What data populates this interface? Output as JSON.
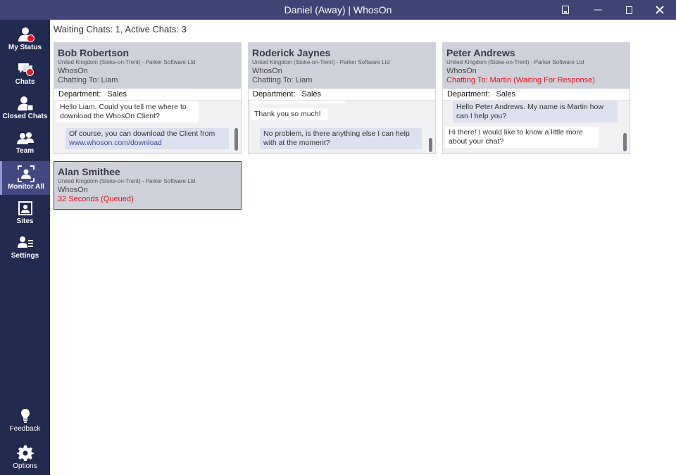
{
  "window": {
    "title": "Daniel (Away)  | WhosOn"
  },
  "sidebar": {
    "items": [
      {
        "label": "My Status",
        "icon": "user-status-icon"
      },
      {
        "label": "Chats",
        "icon": "chat-bubbles-icon"
      },
      {
        "label": "Closed Chats",
        "icon": "closed-chats-icon"
      },
      {
        "label": "Team",
        "icon": "team-icon"
      },
      {
        "label": "Monitor All",
        "icon": "monitor-all-icon",
        "active": true
      },
      {
        "label": "Sites",
        "icon": "sites-icon"
      },
      {
        "label": "Settings",
        "icon": "settings-user-icon"
      }
    ],
    "bottom": [
      {
        "label": "Feedback",
        "icon": "lightbulb-icon"
      },
      {
        "label": "Options",
        "icon": "gear-icon"
      }
    ]
  },
  "main": {
    "summary": "Waiting Chats: 1, Active Chats: 3",
    "cards": [
      {
        "name": "Bob Robertson",
        "location": "United Kingdom (Stoke-on-Trent) - Parker Software Ltd",
        "site": "WhosOn",
        "status": "Chatting To: Liam",
        "department_label": "Department:",
        "department": "Sales",
        "messages": [
          {
            "from": "visitor",
            "text": "Hello Liam. Could you tell me where to download the WhosOn Client?"
          },
          {
            "from": "operator",
            "text": "Of course, you can download the Client from",
            "link": "www.whoson.com/download"
          }
        ]
      },
      {
        "name": "Roderick Jaynes",
        "location": "United Kingdom (Stoke-on-Trent) - Parker Software Ltd",
        "site": "WhosOn",
        "status": "Chatting To: Liam",
        "department_label": "Department:",
        "department": "Sales",
        "messages": [
          {
            "from": "visitor",
            "text": "Thank you so much!"
          },
          {
            "from": "operator",
            "text": "No problem, is there anything else I can help with at the moment?"
          }
        ]
      },
      {
        "name": "Peter Andrews",
        "location": "United Kingdom (Stoke-on-Trent) - Parker Software Ltd",
        "site": "WhosOn",
        "status": "Chatting To: Martin (Waiting For Response)",
        "department_label": "Department:",
        "department": "Sales",
        "messages": [
          {
            "from": "operator",
            "text": "Hello Peter Andrews. My name is Martin how can I help you?"
          },
          {
            "from": "visitor",
            "text": "Hi there! I would like to know a little more about your chat?"
          }
        ]
      },
      {
        "name": "Alan Smithee",
        "location": "United Kingdom (Stoke-on-Trent) - Parker Software Ltd",
        "site": "WhosOn",
        "status": "32 Seconds (Queued)"
      }
    ]
  },
  "colors": {
    "titlebar": "#3f4474",
    "sidebar": "#232a4f",
    "sidebar_active": "#424980",
    "card_header": "#cfd1da",
    "status_red": "#e10f1a",
    "badge_red": "#e31b23"
  }
}
